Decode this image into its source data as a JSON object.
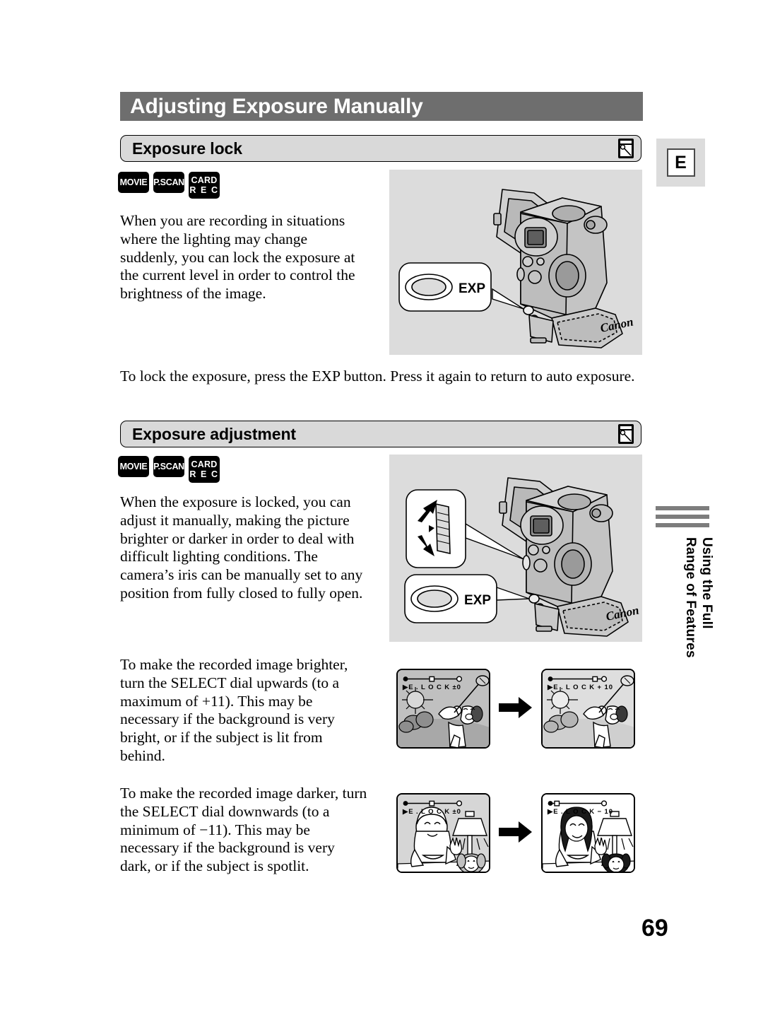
{
  "page": {
    "title": "Adjusting Exposure Manually",
    "number": "69",
    "language_tab": "E",
    "running_head": "Using the Full\nRange of Features"
  },
  "sections": [
    {
      "heading": "Exposure lock",
      "icon": "iris-icon",
      "badges": [
        {
          "name": "movie",
          "lines": [
            "MOVIE"
          ]
        },
        {
          "name": "pscan",
          "lines": [
            "P.SCAN"
          ]
        },
        {
          "name": "card-rec",
          "lines": [
            "CARD",
            "R E C"
          ]
        }
      ],
      "body": "When you are recording in situations where the lighting may change suddenly, you can lock the exposure at the current level in order to control the brightness of the image.",
      "note": "To lock the exposure, press the EXP button. Press it again to return to auto exposure.",
      "illustration": {
        "name": "camcorder-exp-button",
        "callouts": [
          {
            "name": "exp-button-callout",
            "label": "EXP"
          }
        ],
        "brand": "Canon"
      }
    },
    {
      "heading": "Exposure adjustment",
      "icon": "iris-icon",
      "badges": [
        {
          "name": "movie",
          "lines": [
            "MOVIE"
          ]
        },
        {
          "name": "pscan",
          "lines": [
            "P.SCAN"
          ]
        },
        {
          "name": "card-rec",
          "lines": [
            "CARD",
            "R E C"
          ]
        }
      ],
      "body": "When the exposure is locked, you can adjust it manually, making the picture brighter or darker in order to deal with difficult lighting conditions. The camera’s iris can be manually set to any position from fully closed to fully open.",
      "illustration": {
        "name": "camcorder-select-dial-and-exp",
        "callouts": [
          {
            "name": "select-dial-callout",
            "label": ""
          },
          {
            "name": "exp-button-callout",
            "label": "EXP"
          }
        ],
        "brand": "Canon"
      }
    }
  ],
  "instructions": [
    {
      "name": "brighten-instruction",
      "text": "To make the recorded image brighter, turn the SELECT dial upwards (to a maximum of +11). This may be necessary if the background is very bright, or if the subject is lit from behind.",
      "screens": [
        {
          "name": "lcd-golf-before",
          "osd": "▶E . L O C K   ±0",
          "marker": "center",
          "scene": "golfer-outdoor",
          "brightness": "normal"
        },
        {
          "name": "lcd-golf-after",
          "osd": "▶E . L O C K   + 10",
          "marker": "right",
          "scene": "golfer-outdoor",
          "brightness": "bright"
        }
      ]
    },
    {
      "name": "darken-instruction",
      "text": "To make the recorded image darker, turn the SELECT dial downwards (to a minimum of −11). This may be necessary if the background is very dark, or if the subject is spotlit.",
      "screens": [
        {
          "name": "lcd-lamp-before",
          "osd": "▶E . L O C K   ±0",
          "marker": "center",
          "scene": "girl-lamp-indoor",
          "brightness": "normal"
        },
        {
          "name": "lcd-lamp-after",
          "osd": "▶E . L O C K   − 10",
          "marker": "left",
          "scene": "girl-lamp-indoor",
          "brightness": "dark"
        }
      ]
    }
  ],
  "colors": {
    "title_bar": "#6e6e6e",
    "section_bar": "#d9d9d9",
    "illustration_bg": "#dcdcdc",
    "side_bar": "#7d7d7d"
  }
}
